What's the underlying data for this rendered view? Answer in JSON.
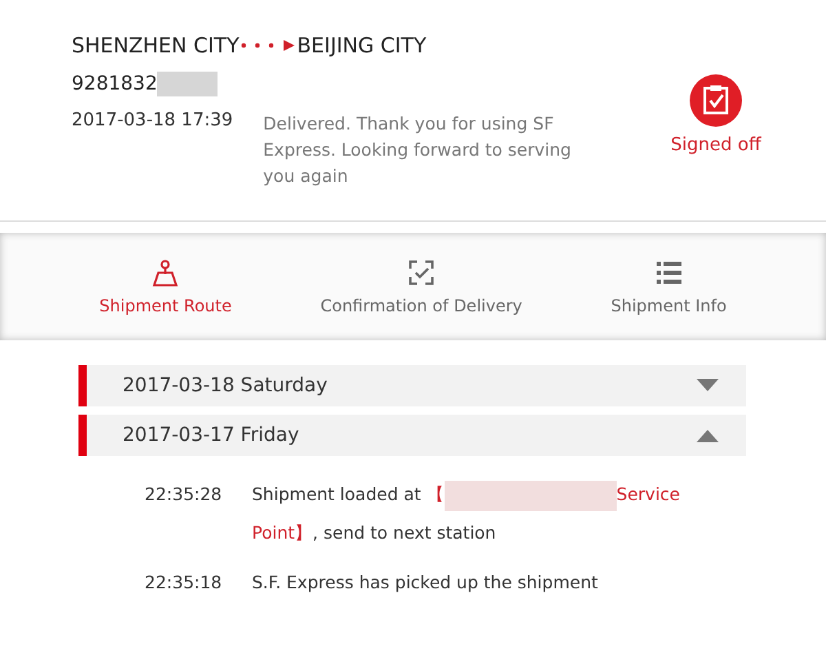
{
  "route": {
    "origin": "SHENZHEN CITY",
    "destination": "BEIJING CITY"
  },
  "waybill": {
    "number": "9281832",
    "redacted": true
  },
  "latest": {
    "time": "2017-03-18 17:39",
    "message": "Delivered. Thank you for using SF Express. Looking forward to serving you again"
  },
  "status": {
    "label": "Signed off"
  },
  "tabs": [
    {
      "label": "Shipment Route",
      "kind": "map",
      "selected": true
    },
    {
      "label": "Confirmation of Delivery",
      "kind": "check",
      "selected": false
    },
    {
      "label": "Shipment Info",
      "kind": "list",
      "selected": false
    }
  ],
  "days": [
    {
      "date": "2017-03-18 Saturday",
      "expanded": false
    },
    {
      "date": "2017-03-17 Friday",
      "expanded": true,
      "events": [
        {
          "time": "22:35:28",
          "parts": [
            {
              "kind": "plain",
              "text": "Shipment loaded at "
            },
            {
              "kind": "highlight",
              "text": "【"
            },
            {
              "kind": "redacted"
            },
            {
              "kind": "highlight",
              "text": "Service Point】"
            },
            {
              "kind": "plain",
              "text": ", send to next station"
            }
          ]
        },
        {
          "time": "22:35:18",
          "parts": [
            {
              "kind": "plain",
              "text": "S.F. Express has picked up the shipment"
            }
          ]
        }
      ]
    }
  ]
}
